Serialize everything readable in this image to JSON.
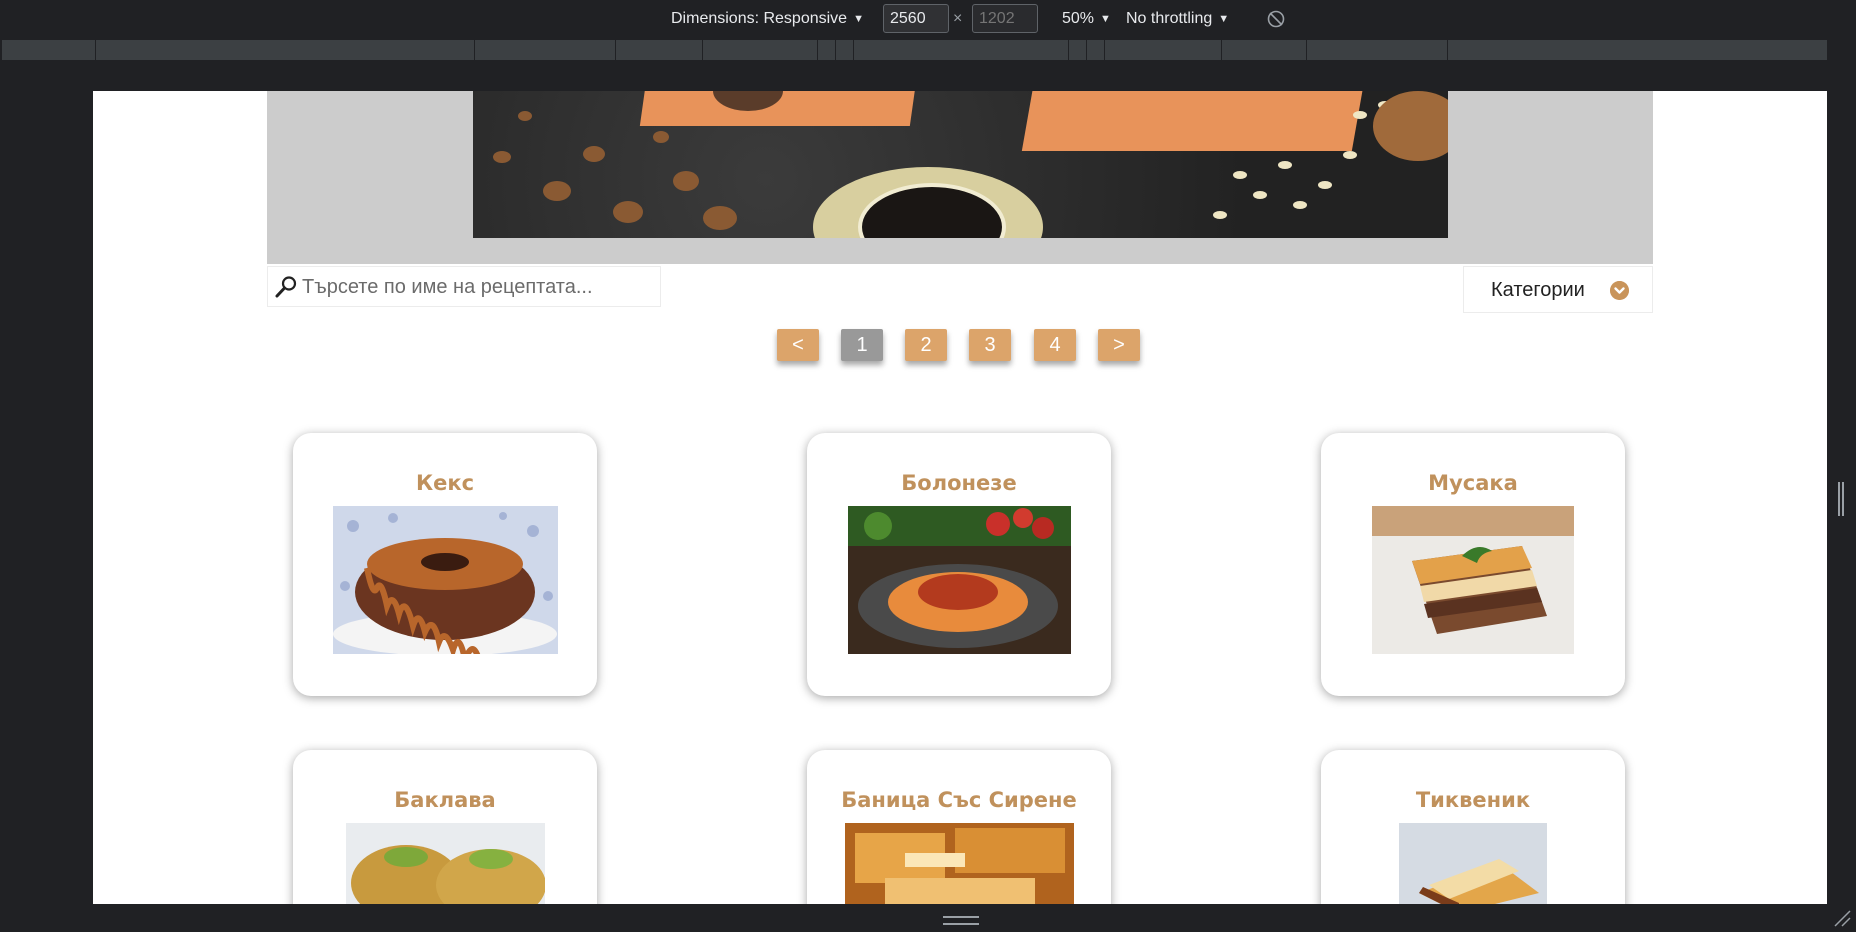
{
  "devtools": {
    "dimensions_label": "Dimensions: Responsive",
    "width_value": "2560",
    "height_placeholder": "1202",
    "times_symbol": "×",
    "zoom_label": "50%",
    "throttling_label": "No throttling"
  },
  "page": {
    "search": {
      "placeholder": "Търсете по име на рецептата..."
    },
    "categories": {
      "label": "Категории"
    },
    "pagination": {
      "prev_label": "<",
      "pages": [
        "1",
        "2",
        "3",
        "4"
      ],
      "active_page": "1",
      "next_label": ">"
    },
    "recipes": [
      {
        "title": "Кекс"
      },
      {
        "title": "Болонезе"
      },
      {
        "title": "Мусака"
      },
      {
        "title": "Баклава"
      },
      {
        "title": "Баница Със Сирене"
      },
      {
        "title": "Тиквеник"
      }
    ]
  },
  "colors": {
    "accent": "#c0915c",
    "pager_bg": "#dca46a",
    "pager_active_bg": "#999999",
    "hero_bg": "#cccccc"
  }
}
